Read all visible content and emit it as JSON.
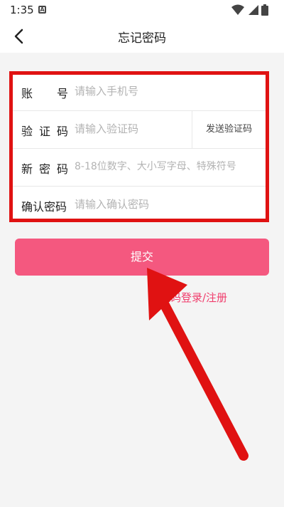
{
  "status_bar": {
    "time": "1:35",
    "app_icon": "A"
  },
  "header": {
    "title": "忘记密码",
    "back_icon": "chevron-left-icon"
  },
  "form": {
    "account": {
      "label_chars": [
        "账",
        "号"
      ],
      "placeholder": "请输入手机号"
    },
    "code": {
      "label_chars": [
        "验",
        "证",
        "码"
      ],
      "placeholder": "请输入验证码",
      "send_button": "发送验证码"
    },
    "new_password": {
      "label_chars": [
        "新",
        "密",
        "码"
      ],
      "placeholder": "8-18位数字、大小写字母、特殊符号"
    },
    "confirm_password": {
      "label": "确认密码",
      "placeholder": "请输入确认密码"
    }
  },
  "submit_label": "提交",
  "alt_link": "验证码登录/注册",
  "colors": {
    "accent": "#f4587f",
    "link": "#f03d6c",
    "annotation": "#e01212"
  }
}
